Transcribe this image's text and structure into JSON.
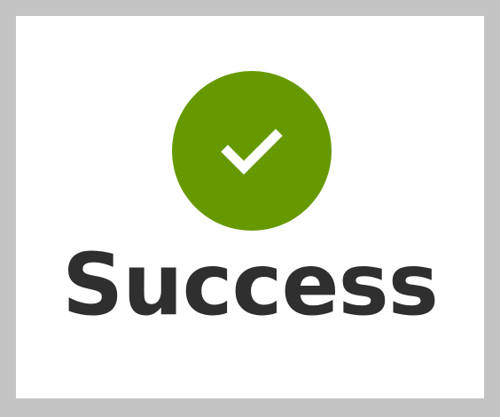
{
  "status": {
    "title": "Success",
    "icon": "checkmark-icon"
  },
  "colors": {
    "background": "#c4c4c4",
    "panel": "#ffffff",
    "success": "#669900",
    "text": "#2f2f2f",
    "check": "#ffffff"
  }
}
